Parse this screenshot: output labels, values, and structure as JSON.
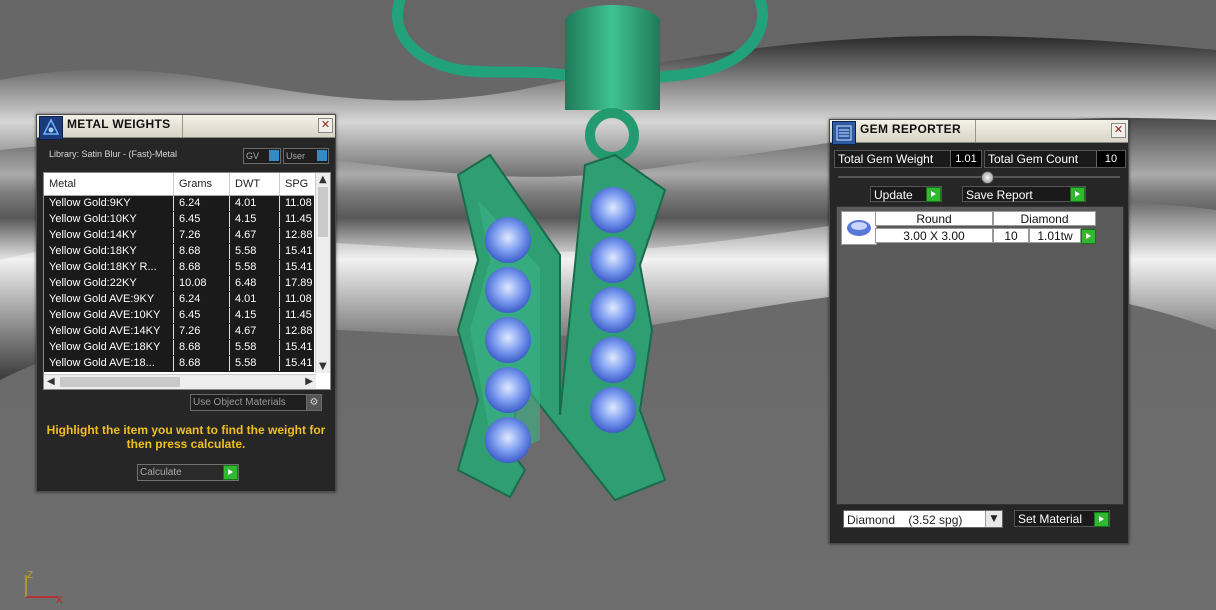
{
  "metal_weights": {
    "title": "METAL WEIGHTS",
    "library_label": "Library: Satin Blur - (Fast)-Metal",
    "gv_label": "GV",
    "user_label": "User",
    "columns": [
      "Metal",
      "Grams",
      "DWT",
      "SPG"
    ],
    "rows": [
      {
        "metal": "Yellow Gold:9KY",
        "grams": "6.24",
        "dwt": "4.01",
        "spg": "11.08"
      },
      {
        "metal": "Yellow Gold:10KY",
        "grams": "6.45",
        "dwt": "4.15",
        "spg": "11.45"
      },
      {
        "metal": "Yellow Gold:14KY",
        "grams": "7.26",
        "dwt": "4.67",
        "spg": "12.88"
      },
      {
        "metal": "Yellow Gold:18KY",
        "grams": "8.68",
        "dwt": "5.58",
        "spg": "15.41"
      },
      {
        "metal": "Yellow Gold:18KY R...",
        "grams": "8.68",
        "dwt": "5.58",
        "spg": "15.41"
      },
      {
        "metal": "Yellow Gold:22KY",
        "grams": "10.08",
        "dwt": "6.48",
        "spg": "17.89"
      },
      {
        "metal": "Yellow Gold AVE:9KY",
        "grams": "6.24",
        "dwt": "4.01",
        "spg": "11.08"
      },
      {
        "metal": "Yellow Gold AVE:10KY",
        "grams": "6.45",
        "dwt": "4.15",
        "spg": "11.45"
      },
      {
        "metal": "Yellow Gold AVE:14KY",
        "grams": "7.26",
        "dwt": "4.67",
        "spg": "12.88"
      },
      {
        "metal": "Yellow Gold AVE:18KY",
        "grams": "8.68",
        "dwt": "5.58",
        "spg": "15.41"
      },
      {
        "metal": "Yellow Gold AVE:18...",
        "grams": "8.68",
        "dwt": "5.58",
        "spg": "15.41"
      }
    ],
    "use_object_materials": "Use Object Materials",
    "instruction": "Highlight the item you want to find the weight for then press calculate.",
    "calculate_label": "Calculate"
  },
  "gem_reporter": {
    "title": "GEM REPORTER",
    "total_weight_label": "Total Gem Weight",
    "total_weight_value": "1.01",
    "total_count_label": "Total Gem Count",
    "total_count_value": "10",
    "update_label": "Update",
    "save_report_label": "Save Report",
    "gem_row": {
      "cut": "Round",
      "material": "Diamond",
      "size": "3.00 X 3.00",
      "count": "10",
      "weight": "1.01tw"
    },
    "material_select": "Diamond    (3.52 spg)",
    "set_material_label": "Set Material"
  },
  "axis": {
    "z": "Z",
    "x": "X"
  },
  "colors": {
    "accent_green": "#2fb830",
    "instruction_yellow": "#f0c020",
    "pendant_green": "#2e9c74",
    "gem_blue": "#6a8ee8"
  }
}
